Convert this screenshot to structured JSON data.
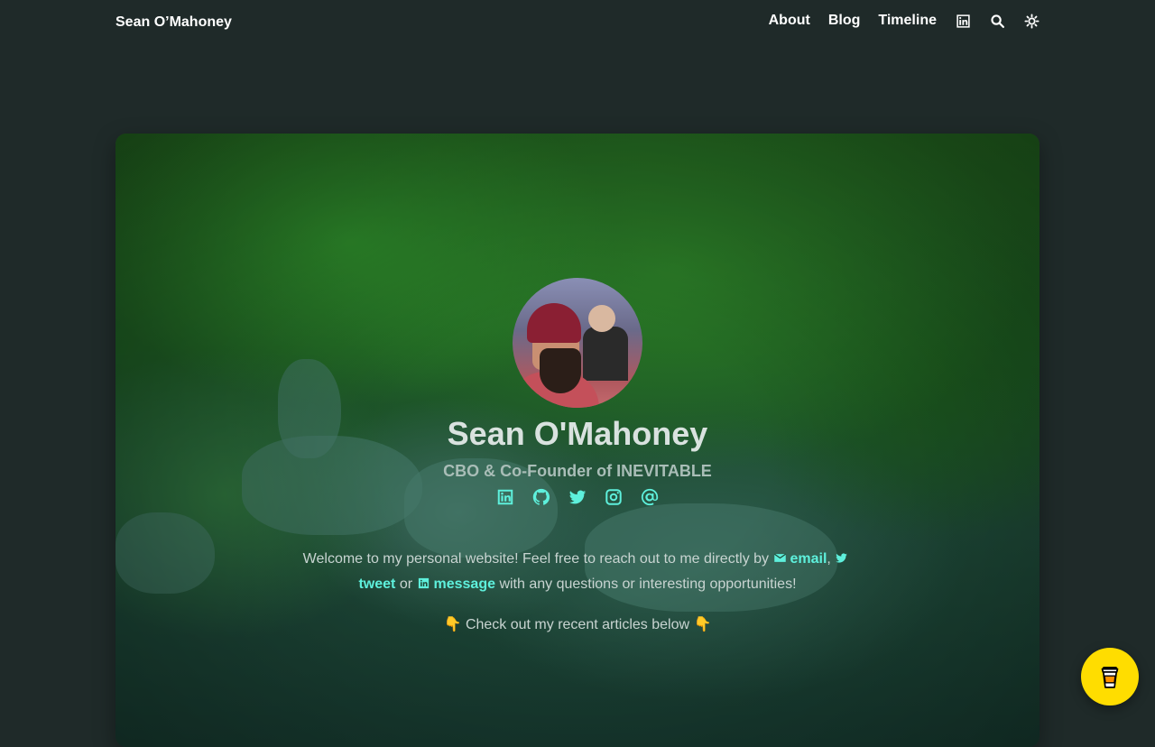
{
  "header": {
    "brand": "Sean O’Mahoney",
    "nav": [
      {
        "label": "About"
      },
      {
        "label": "Blog"
      },
      {
        "label": "Timeline"
      }
    ],
    "icons": [
      "linkedin-icon",
      "search-icon",
      "theme-toggle-icon"
    ]
  },
  "profile": {
    "name": "Sean O'Mahoney",
    "role": "CBO & Co-Founder of INEVITABLE",
    "socials": [
      "linkedin-icon",
      "github-icon",
      "twitter-icon",
      "instagram-icon",
      "at-icon"
    ]
  },
  "intro": {
    "before": "Welcome to my personal website! Feel free to reach out to me directly by ",
    "email_label": "email",
    "comma": ", ",
    "tweet_label": "tweet",
    "or": " or ",
    "message_label": "message",
    "after": " with any questions or interesting opportunities!"
  },
  "articles_note": "👇 Check out my recent articles below 👇",
  "colors": {
    "background": "#1f2a29",
    "accent": "#5ef0dc",
    "bmc_yellow": "#ffdd00"
  }
}
